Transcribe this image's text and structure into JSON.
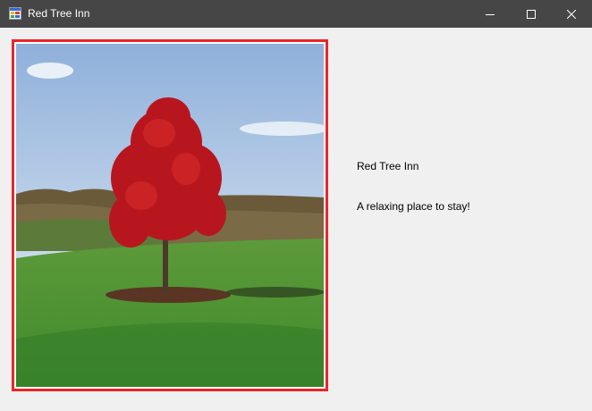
{
  "window": {
    "title": "Red Tree Inn",
    "icon": "app-form-icon",
    "controls": [
      "minimize-icon",
      "maximize-icon",
      "close-icon"
    ]
  },
  "content": {
    "heading": "Red Tree Inn",
    "tagline": "A relaxing place to stay!",
    "picture": "red-tree-photo"
  },
  "colors": {
    "titlebar": "#464646",
    "picture_border": "#e8262b",
    "background": "#f0f0f0"
  }
}
